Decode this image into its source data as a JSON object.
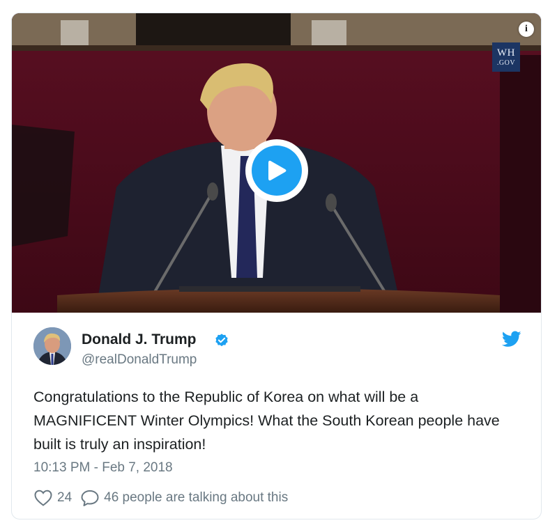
{
  "video": {
    "badge_line1": "WH",
    "badge_line2": ".GOV",
    "info_icon": "info-icon",
    "play_icon": "play-icon"
  },
  "tweet": {
    "author_name": "Donald J. Trump",
    "handle": "@realDonaldTrump",
    "verified_icon": "verified-badge-icon",
    "brand_icon": "twitter-bird-icon",
    "text": "Congratulations to the Republic of Korea on what will be a MAGNIFICENT Winter Olympics! What the South Korean people have built is truly an inspiration!",
    "timestamp": "10:13 PM - Feb 7, 2018",
    "like_count": "24",
    "talking_text": "46 people are talking about this"
  },
  "colors": {
    "accent": "#1da1f2",
    "text_primary": "#1c2022",
    "text_secondary": "#697882",
    "border": "#e1e8ed"
  }
}
